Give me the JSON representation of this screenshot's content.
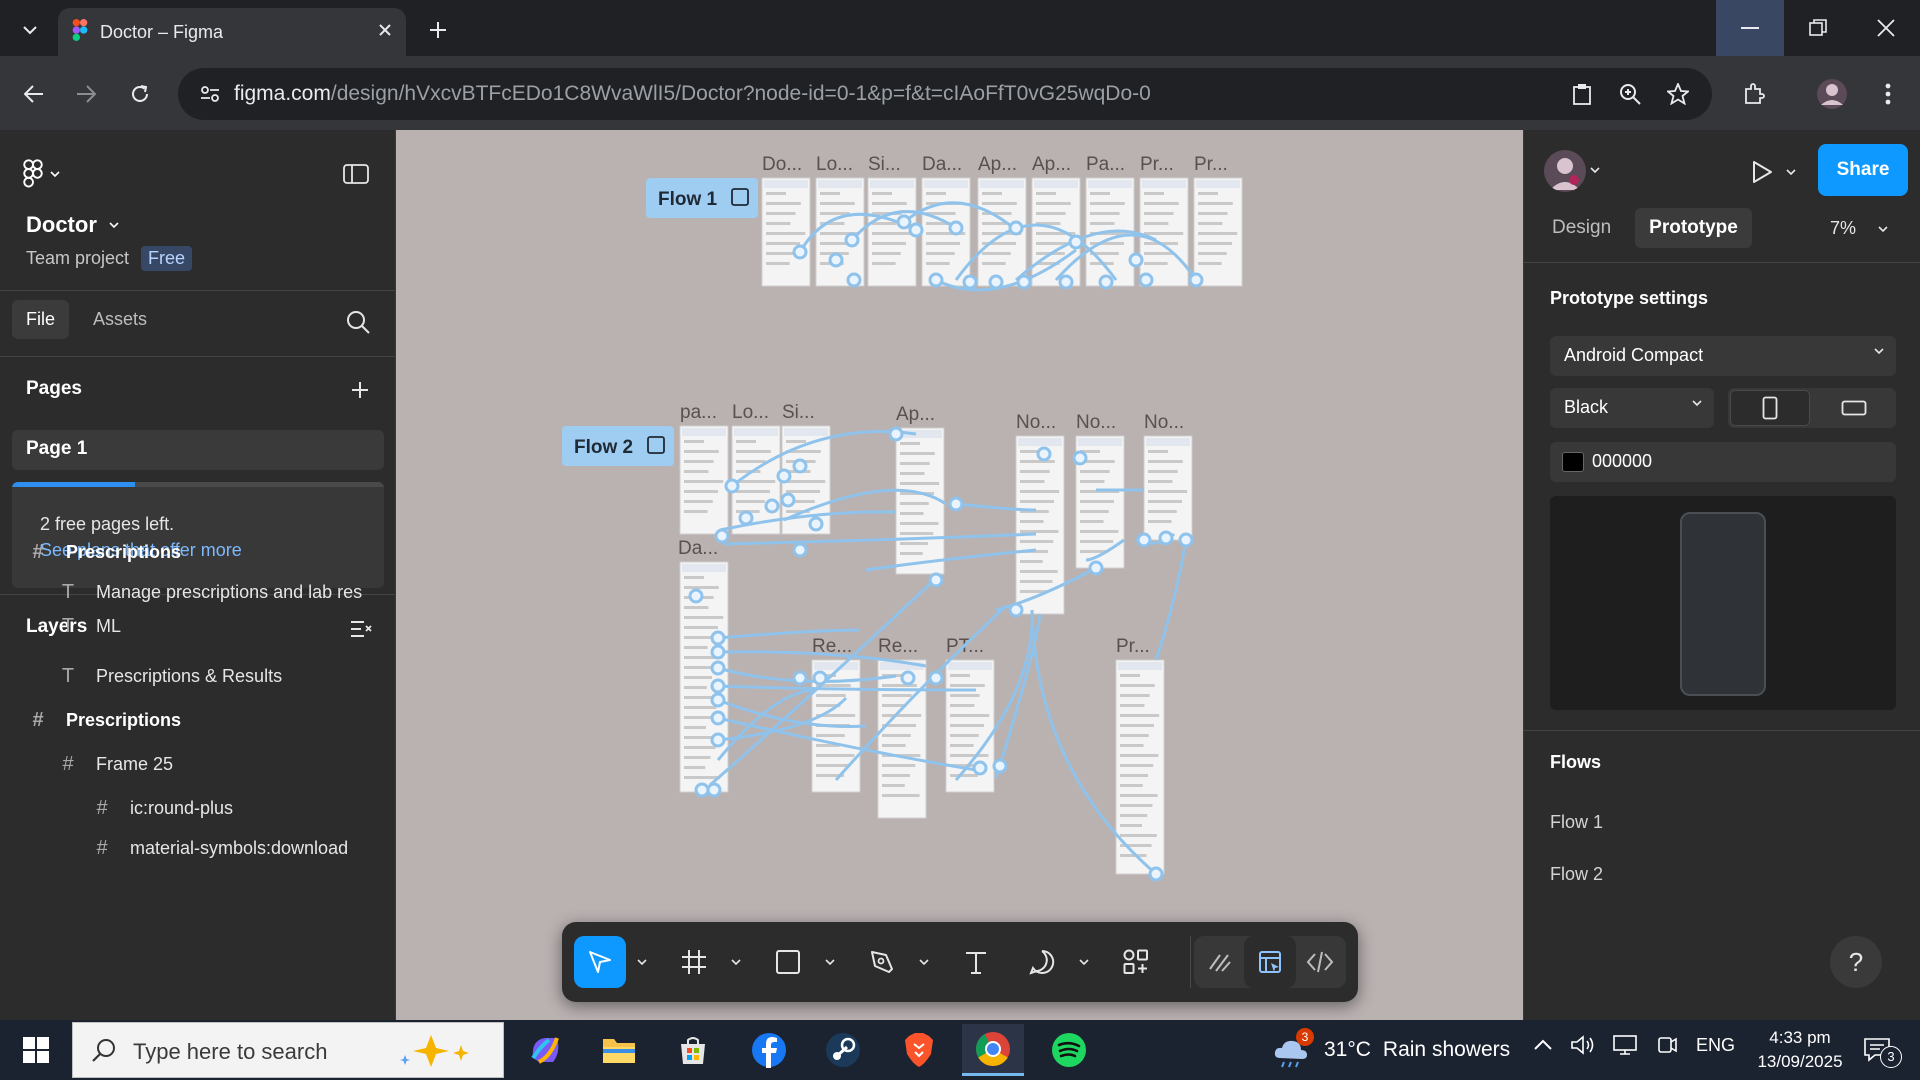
{
  "browser": {
    "tab_title": "Doctor – Figma",
    "url_host": "figma.com",
    "url_path": "/design/hVxcvBTFcEDo1C8WvaWlI5/Doctor?node-id=0-1&p=f&t=cIAoFfT0vG25wqDo-0"
  },
  "left_panel": {
    "file_name": "Doctor",
    "team": "Team project",
    "plan_badge": "Free",
    "tabs": {
      "file": "File",
      "assets": "Assets"
    },
    "pages_title": "Pages",
    "pages": [
      "Page 1"
    ],
    "upsell_text": "2 free pages left.",
    "upsell_link": "See plans that offer more",
    "upsell_progress": 0.33,
    "layers_title": "Layers",
    "layers": [
      {
        "icon": "frame-icon",
        "name": "Prescriptions",
        "bold": true
      },
      {
        "icon": "text-icon",
        "name": "Manage prescriptions and lab res",
        "bold": false
      },
      {
        "icon": "text-icon",
        "name": "ML",
        "bold": false
      },
      {
        "icon": "text-icon",
        "name": "Prescriptions & Results",
        "bold": false
      },
      {
        "icon": "frame-icon",
        "name": "Prescriptions",
        "bold": true
      },
      {
        "icon": "frame-icon",
        "name": "Frame 25",
        "bold": false
      },
      {
        "icon": "frame-icon",
        "name": "ic:round-plus",
        "bold": false
      },
      {
        "icon": "frame-icon",
        "name": "material-symbols:download",
        "bold": false
      }
    ]
  },
  "canvas": {
    "flow1_label": "Flow 1",
    "flow2_label": "Flow 2",
    "flow1_frame_labels": [
      "Do...",
      "Lo...",
      "Si...",
      "Da...",
      "Ap...",
      "Ap...",
      "Pa...",
      "Pr...",
      "Pr..."
    ],
    "flow2_frame_labels": [
      "pa...",
      "Lo...",
      "Si...",
      "Ap...",
      "No...",
      "No...",
      "No...",
      "Da...",
      "Re...",
      "Re...",
      "PT...",
      "Pr..."
    ]
  },
  "right_panel": {
    "share_label": "Share",
    "tabs": {
      "design": "Design",
      "prototype": "Prototype"
    },
    "zoom": "7%",
    "proto_title": "Prototype settings",
    "device": "Android Compact",
    "device_color": "Black",
    "background_hex": "000000",
    "flows_title": "Flows",
    "flows": [
      "Flow 1",
      "Flow 2"
    ],
    "help": "?"
  },
  "taskbar": {
    "search_placeholder": "Type here to search",
    "weather_badge": "3",
    "weather_temp": "31°C",
    "weather_desc": "Rain showers",
    "language": "ENG",
    "time": "4:33 pm",
    "date": "13/09/2025",
    "notification_count": "3"
  },
  "colors": {
    "accent": "#0d99ff",
    "canvas_bg": "#bab1b1",
    "flow_connector": "#8fc3ec"
  }
}
